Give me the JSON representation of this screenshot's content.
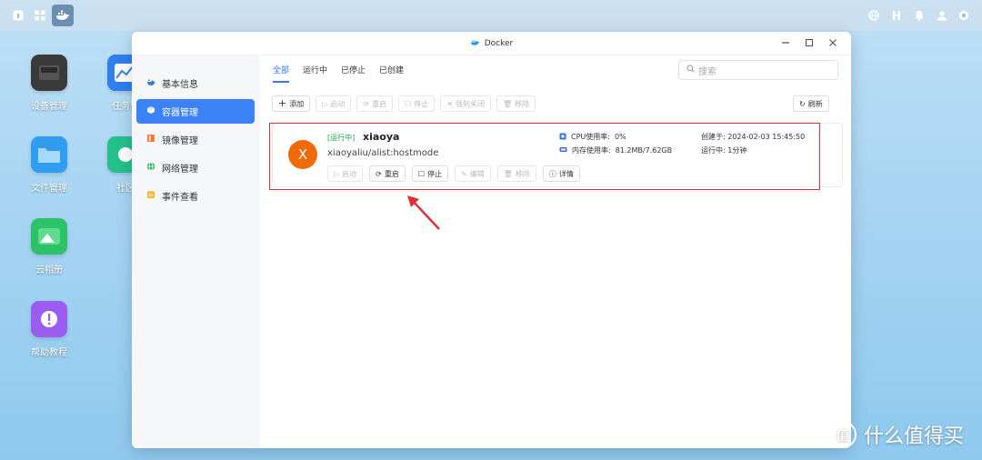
{
  "topbar": {
    "left_icons": [
      "home-icon",
      "apps-grid-icon",
      "docker-icon"
    ],
    "right_icons": [
      "globe-icon",
      "network-icon",
      "bell-icon",
      "user-icon",
      "settings-icon"
    ]
  },
  "desktop": {
    "icons": [
      {
        "label": "设备管理",
        "icon": "device-icon",
        "color": "#3a3a3a"
      },
      {
        "label": "任务管",
        "icon": "task-icon",
        "color": "#2f80ed"
      },
      {
        "label": "文件管理",
        "icon": "folder-icon",
        "color": "#2f9df0"
      },
      {
        "label": "社区",
        "icon": "community-icon",
        "color": "#25c18a"
      },
      {
        "label": "云相册",
        "icon": "photo-icon",
        "color": "#2bc26a"
      },
      {
        "label": "帮助教程",
        "icon": "help-icon",
        "color": "#9b5cf0"
      }
    ]
  },
  "window": {
    "title": "Docker",
    "controls": [
      "minimize",
      "maximize",
      "close"
    ]
  },
  "sidebar": {
    "items": [
      {
        "label": "基本信息",
        "icon": "info-icon",
        "active": false
      },
      {
        "label": "容器管理",
        "icon": "container-icon",
        "active": true
      },
      {
        "label": "镜像管理",
        "icon": "image-icon",
        "active": false
      },
      {
        "label": "网络管理",
        "icon": "network-globe-icon",
        "active": false
      },
      {
        "label": "事件查看",
        "icon": "event-icon",
        "active": false
      }
    ]
  },
  "tabs": [
    {
      "label": "全部",
      "active": true
    },
    {
      "label": "运行中",
      "active": false
    },
    {
      "label": "已停止",
      "active": false
    },
    {
      "label": "已创建",
      "active": false
    }
  ],
  "search": {
    "placeholder": "搜索"
  },
  "toolbar": {
    "add": "添加",
    "start": "启动",
    "restart": "重启",
    "stop": "停止",
    "force_stop": "强制关闭",
    "remove": "移除",
    "refresh": "刷新"
  },
  "container": {
    "avatar_letter": "X",
    "status": "[运行中]",
    "name": "xiaoya",
    "image": "xiaoyaliu/alist:hostmode",
    "cpu_label": "CPU使用率:",
    "cpu_value": "0%",
    "mem_label": "内存使用率:",
    "mem_value": "81.2MB/7.62GB",
    "created_label": "创建于:",
    "created_value": "2024-02-03 15:45:50",
    "running_label": "运行中:",
    "running_value": "1分钟",
    "actions": {
      "start": "启动",
      "restart": "重启",
      "stop": "停止",
      "edit": "编辑",
      "remove": "移除",
      "details": "详情"
    }
  },
  "watermark": {
    "logo": "值",
    "text": "什么值得买"
  },
  "colors": {
    "accent": "#2f7cf6",
    "running": "#1aa34a",
    "highlight": "#e0303a",
    "avatar": "#f06a0a"
  }
}
